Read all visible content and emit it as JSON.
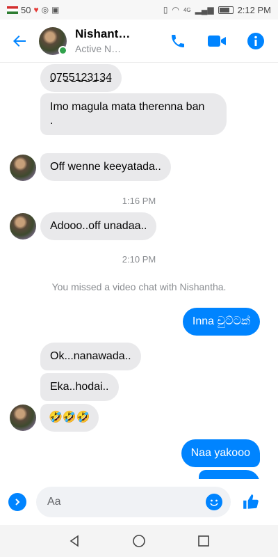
{
  "status_bar": {
    "left_text": "50",
    "time": "2:12 PM",
    "network": "4G"
  },
  "header": {
    "contact_name": "Nishant…",
    "contact_status": "Active N…"
  },
  "messages": [
    {
      "direction": "in",
      "text": "0755123134"
    },
    {
      "direction": "in",
      "text": "Imo magula mata therenna ban"
    },
    {
      "direction": "in",
      "text": "."
    },
    {
      "direction": "in",
      "text": "Off wenne keeyatada.."
    },
    {
      "direction": "in",
      "text": "Adooo..off unadaa.."
    },
    {
      "direction": "out",
      "text": "Inna චුට්ටක්"
    },
    {
      "direction": "in",
      "text": "Ok...nanawada.."
    },
    {
      "direction": "in",
      "text": "Eka..hodai.."
    },
    {
      "direction": "in",
      "text": "🤣🤣🤣"
    },
    {
      "direction": "out",
      "text": "Naa yakooo"
    }
  ],
  "timestamps": [
    "1:16 PM",
    "2:10 PM"
  ],
  "system_note": "You missed a video chat with Nishantha.",
  "composer": {
    "placeholder": "Aa"
  },
  "colors": {
    "accent": "#0084ff",
    "incoming_bubble": "#e9e9eb",
    "online": "#31a24c"
  },
  "icons": {
    "back": "arrow-left-icon",
    "call": "phone-icon",
    "video": "video-camera-icon",
    "info": "info-icon",
    "expand": "chevron-right-icon",
    "emoji": "smiley-icon",
    "like": "thumbs-up-icon"
  }
}
